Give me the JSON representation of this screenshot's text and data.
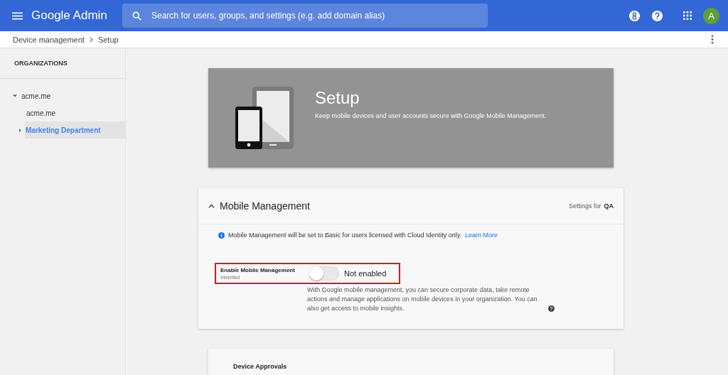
{
  "app": {
    "title": "Google Admin",
    "avatar": "A"
  },
  "search": {
    "placeholder": "Search for users, groups, and settings (e.g. add domain alias)"
  },
  "breadcrumb": [
    "Device management",
    "Setup"
  ],
  "sidebar": {
    "heading": "ORGANIZATIONS",
    "tree": [
      {
        "label": "acme.me",
        "expanded": true,
        "selected": false,
        "children": [
          {
            "label": "acme.me",
            "selected": false
          },
          {
            "label": "Marketing Department",
            "selected": true,
            "expanded": false
          }
        ]
      }
    ]
  },
  "hero": {
    "title": "Setup",
    "subtitle": "Keep mobile devices and user accounts secure with Google Mobile Management."
  },
  "section": {
    "title": "Mobile Management",
    "expanded": true,
    "settings_for": "Settings for",
    "org": "QA",
    "info": "Mobile Management will be set to Basic for users licensed with Cloud Identity only.",
    "link": "Learn More",
    "setting": {
      "label": "Enable Mobile Management",
      "sublabel": "Inherited",
      "on": false,
      "status": "Not enabled",
      "highlighted": true,
      "description": "With Google mobile management, you can secure corporate data, take remote actions and manage applications on mobile devices in your organization. You can also get access to mobile insights."
    }
  },
  "next_section": {
    "title": "Device Approvals"
  }
}
